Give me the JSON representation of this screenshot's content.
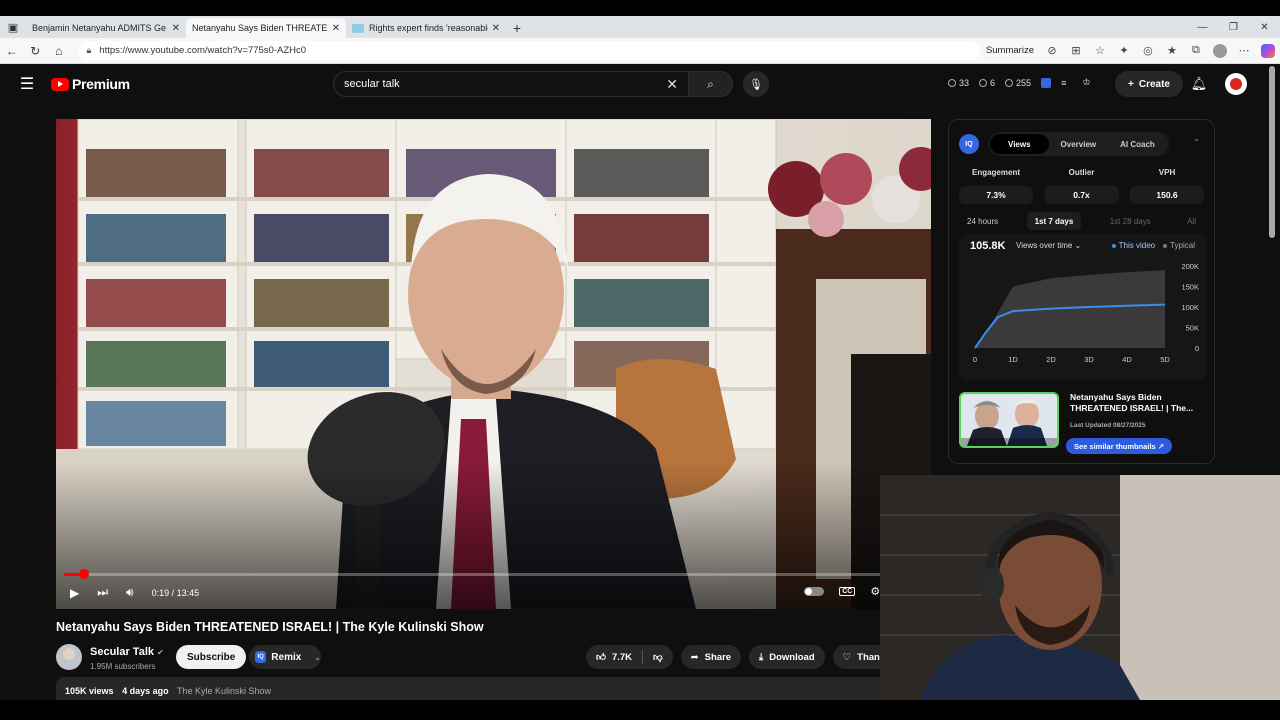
{
  "browser": {
    "tabs": [
      {
        "title": "Benjamin Netanyahu ADMITS Ge",
        "icon": "youtube-icon",
        "active": false
      },
      {
        "title": "Netanyahu Says Biden THREATEN",
        "icon": "youtube-icon",
        "active": true
      },
      {
        "title": "Rights expert finds 'reasonable g",
        "icon": "doc-icon",
        "active": false
      }
    ],
    "url": "https://www.youtube.com/watch?v=775s0-AZHc0",
    "summarize_label": "Summarize"
  },
  "youtube": {
    "logo_text": "Premium",
    "search_query": "secular talk",
    "header_stats": {
      "a": "33",
      "b": "6",
      "c": "255"
    },
    "create_label": "Create",
    "video": {
      "current_time": "0:19",
      "duration": "13:45",
      "time_display": "0:19 / 13:45",
      "progress": 0.023
    },
    "title": "Netanyahu Says Biden THREATENED ISRAEL! | The Kyle Kulinski Show",
    "channel": {
      "name": "Secular Talk",
      "subscribers": "1.95M subscribers"
    },
    "subscribe_label": "Subscribe",
    "remix_label": "Remix",
    "likes": "7.7K",
    "share_label": "Share",
    "download_label": "Download",
    "thanks_label": "Than",
    "meta": {
      "views": "105K views",
      "age": "4 days ago",
      "tag": "The Kyle Kulinski Show"
    }
  },
  "iq_panel": {
    "logo": "IQ",
    "tabs": [
      "Views",
      "Overview",
      "AI Coach"
    ],
    "active_tab": "Views",
    "metrics": [
      {
        "label": "Engagement",
        "value": "7.3%"
      },
      {
        "label": "Outlier",
        "value": "0.7x"
      },
      {
        "label": "VPH",
        "value": "150.6"
      }
    ],
    "periods": [
      "24 hours",
      "1st 7 days",
      "1st 28 days",
      "All"
    ],
    "active_period": "1st 7 days",
    "views_total": "105.8K",
    "dropdown_label": "Views over time",
    "legend": {
      "this_video": "This video",
      "typical": "Typical"
    },
    "thumbnail": {
      "title": "Netanyahu Says Biden THREATENED ISRAEL! | The...",
      "last_updated": "Last Updated 08/27/2025",
      "button": "See similar thumbnails"
    }
  },
  "chart_data": {
    "type": "area",
    "x_ticks": [
      "0",
      "1D",
      "2D",
      "3D",
      "4D",
      "5D"
    ],
    "y_ticks": [
      "200K",
      "150K",
      "100K",
      "50K",
      "0"
    ],
    "ylim": [
      0,
      200000
    ],
    "series": [
      {
        "name": "This video",
        "x": [
          0,
          0.3,
          0.6,
          1,
          2,
          3,
          4,
          5
        ],
        "values": [
          0,
          40000,
          75000,
          90000,
          96000,
          100000,
          103000,
          105800
        ]
      },
      {
        "name": "Typical",
        "x": [
          0,
          0.5,
          1,
          2,
          3,
          4,
          5
        ],
        "values": [
          0,
          70000,
          150000,
          170000,
          178000,
          185000,
          190000
        ]
      }
    ]
  }
}
